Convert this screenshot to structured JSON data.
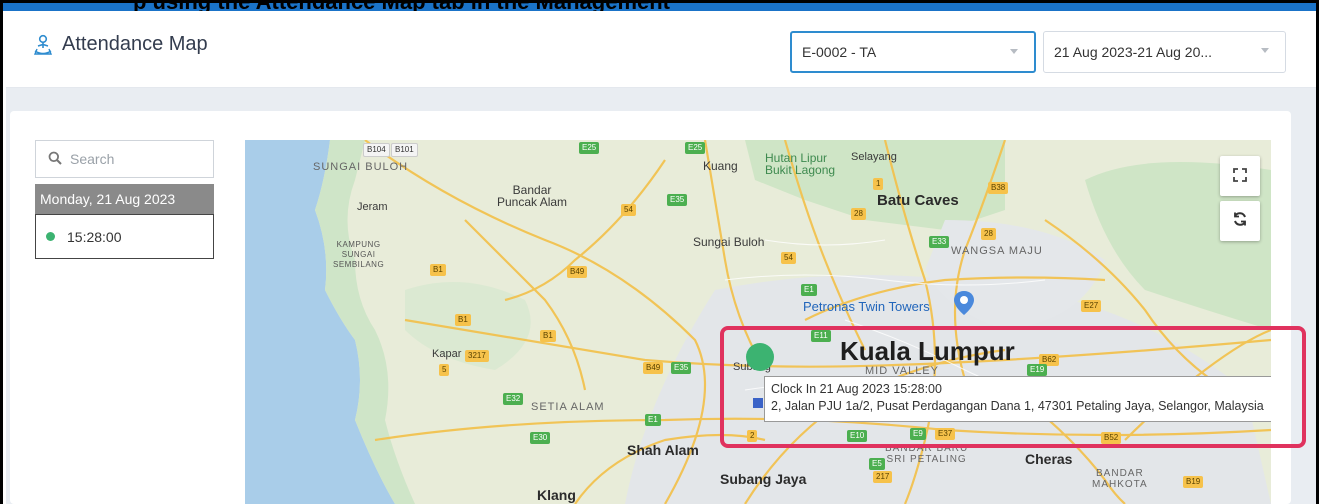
{
  "app": {
    "title": "Attendance Map",
    "icon": "attendance-person-icon"
  },
  "caption_fragment": "p using the Attendance Map tab in the Management",
  "filters": {
    "employee": {
      "value": "E-0002 - TA"
    },
    "date_range": {
      "value": "21 Aug 2023-21 Aug 20..."
    }
  },
  "sidebar": {
    "search_placeholder": "Search",
    "groups": [
      {
        "date": "Monday, 21 Aug 2023",
        "entries": [
          {
            "time": "15:28:00",
            "status_color": "#3cb371"
          }
        ]
      }
    ]
  },
  "map": {
    "tooltip": {
      "line1": "Clock In 21 Aug 2023 15:28:00",
      "line2": "2, Jalan PJU 1a/2, Pusat Perdagangan Dana 1, 47301 Petaling Jaya, Selangor, Malaysia"
    },
    "places": {
      "kuala_lumpur": "Kuala Lumpur",
      "batu_caves": "Batu Caves",
      "wangsa_maju": "WANGSA MAJU",
      "petronas": "Petronas Twin Towers",
      "shah_alam": "Shah Alam",
      "subang_jaya": "Subang Jaya",
      "klang": "Klang",
      "cheras": "Cheras",
      "sungai_buloh_1": "SUNGAI BULOH",
      "sungai_buloh_2": "Sungai Buloh",
      "bandar_puncak_alam": "Bandar\nPuncak Alam",
      "kuang": "Kuang",
      "hutan": "Hutan Lipur\nBukit Lagong",
      "selayang": "Selayang",
      "jeram": "Jeram",
      "kampung": "KAMPUNG\nSUNGAI\nSEMBILANG",
      "kapar": "Kapar",
      "setia_alam": "SETIA ALAM",
      "subang": "Subang",
      "mid_valley": "MID VALLEY",
      "bandar_baru": "BANDAR BARU\nSRI PETALING",
      "bandar_mahkota": "BANDAR\nMAHKOTA"
    },
    "road_numbers": [
      "B104",
      "B101",
      "E25",
      "E25",
      "B38",
      "54",
      "E35",
      "28",
      "28",
      "E33",
      "54",
      "B1",
      "B49",
      "B1",
      "E1",
      "E27",
      "B1",
      "E11",
      "3217",
      "5",
      "B49",
      "E35",
      "B62",
      "E19",
      "E32",
      "E1",
      "E30",
      "2",
      "E10",
      "E9",
      "E37",
      "B52",
      "E5",
      "217",
      "B19",
      "1"
    ]
  },
  "colors": {
    "accent": "#2e8ccf",
    "marker": "#3cb371",
    "highlight": "#e0325e",
    "date_header_bg": "#8a8a8a"
  }
}
